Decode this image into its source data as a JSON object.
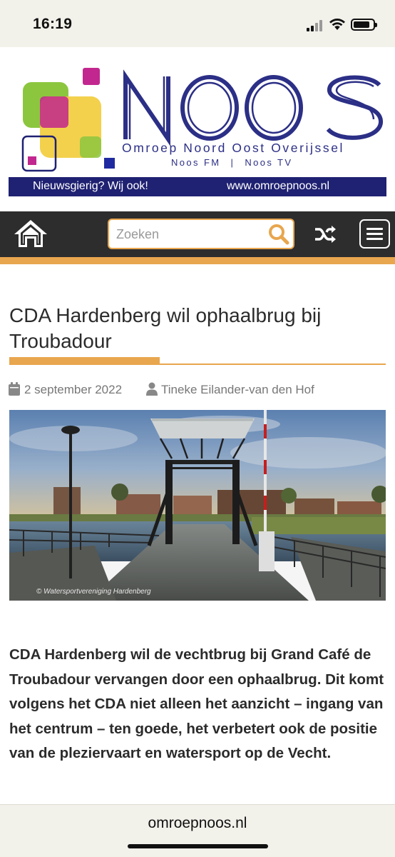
{
  "status_bar": {
    "time": "16:19"
  },
  "banner": {
    "brand_name": "NOOS",
    "tagline": "Omroep Noord Oost Overijssel",
    "sub_left": "Noos FM",
    "sub_separator": "|",
    "sub_right": "Noos TV",
    "strip_left": "Nieuwsgierig? Wij ook!",
    "strip_right": "www.omroepnoos.nl",
    "colors": {
      "navy": "#1f2172",
      "green": "#8cc63f",
      "magenta": "#c2278f",
      "yellow": "#f2cc3a",
      "blue": "#1f2aa0"
    }
  },
  "navbar": {
    "home_icon": "home-icon",
    "search_placeholder": "Zoeken",
    "search_icon": "search-icon",
    "shuffle_icon": "shuffle-icon",
    "menu_icon": "hamburger-menu-icon",
    "accent_color": "#e8a64e",
    "background_color": "#2d2d2d"
  },
  "article": {
    "title": "CDA Hardenberg wil ophaalbrug bij Troubadour",
    "date": "2 september 2022",
    "author": "Tineke Eilander-van den Hof",
    "photo_credit": "© Watersportvereniging Hardenberg",
    "lead": "CDA Hardenberg wil de vechtbrug bij Grand Café de Troubadour vervangen door een ophaalbrug. Dit komt volgens het CDA niet alleen het aanzicht – ingang van het centrum – ten goede, het verbetert ook de positie van de pleziervaart en watersport op de Vecht."
  },
  "browser": {
    "url": "omroepnoos.nl"
  }
}
